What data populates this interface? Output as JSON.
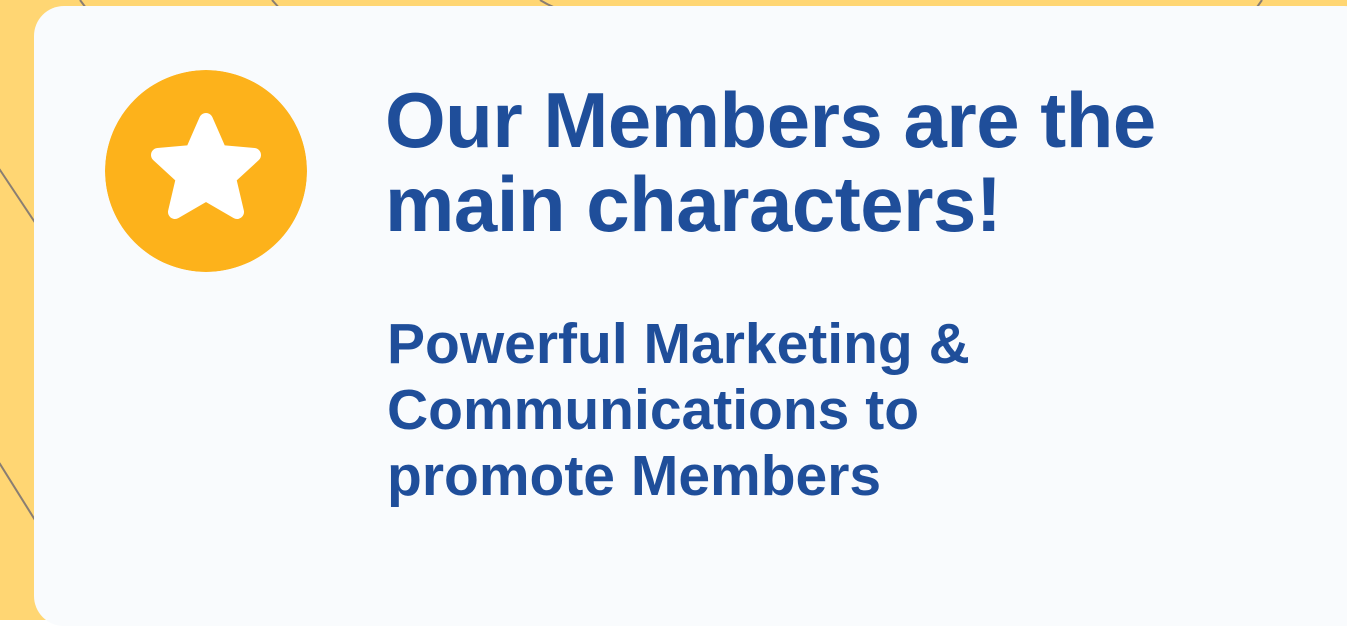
{
  "colors": {
    "background": "#FFD673",
    "line": "#8A7E72",
    "card": "#F9FBFD",
    "badge": "#FDB21B",
    "star": "#FFFFFF",
    "text": "#1F4E9A"
  },
  "icon": "star-icon",
  "headline_line1": "Our Members are the",
  "headline_line2": "main characters!",
  "sub_line1": "Powerful Marketing &",
  "sub_line2": "Communications to",
  "sub_line3": "promote Members"
}
